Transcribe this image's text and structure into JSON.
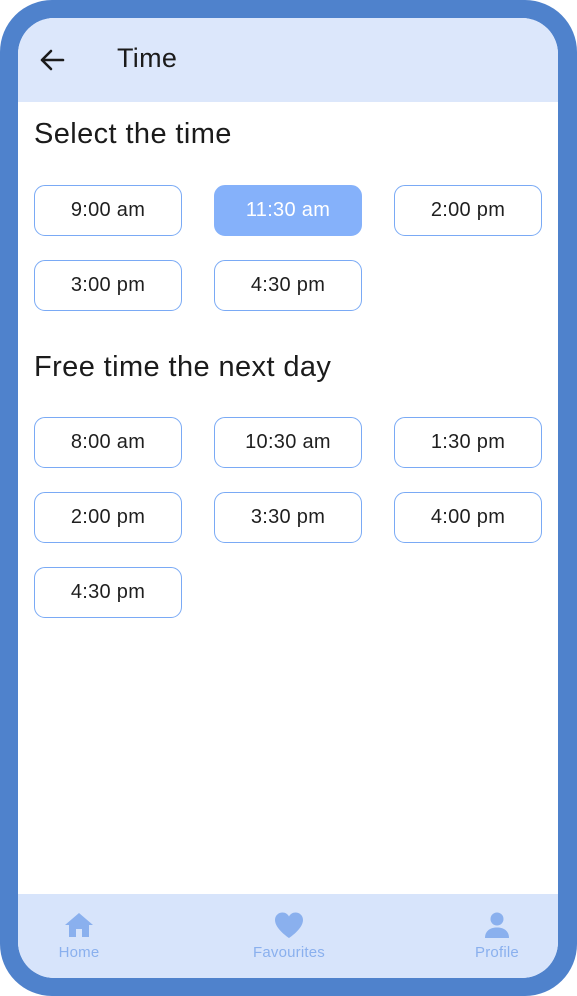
{
  "header": {
    "title": "Time",
    "back_icon": "arrow-left-icon"
  },
  "sections": [
    {
      "title": "Select the time",
      "slots": [
        "9:00 am",
        "11:30 am",
        "2:00 pm",
        "3:00 pm",
        "4:30 pm"
      ],
      "selected": "11:30 am"
    },
    {
      "title": "Free time the next day",
      "slots": [
        "8:00 am",
        "10:30 am",
        "1:30 pm",
        "2:00 pm",
        "3:30 pm",
        "4:00 pm",
        "4:30 pm"
      ]
    }
  ],
  "bottom_nav": {
    "items": [
      {
        "label": "Home",
        "icon": "home-icon"
      },
      {
        "label": "Favourites",
        "icon": "heart-icon"
      },
      {
        "label": "Profile",
        "icon": "user-icon"
      }
    ]
  },
  "colors": {
    "frame": "#4f82cc",
    "header_bg": "#dce7fb",
    "slot_border": "#7aaaf5",
    "slot_selected": "#85b1fa",
    "nav_bg": "#d7e4fb",
    "nav_icon": "#8ab0ee"
  }
}
